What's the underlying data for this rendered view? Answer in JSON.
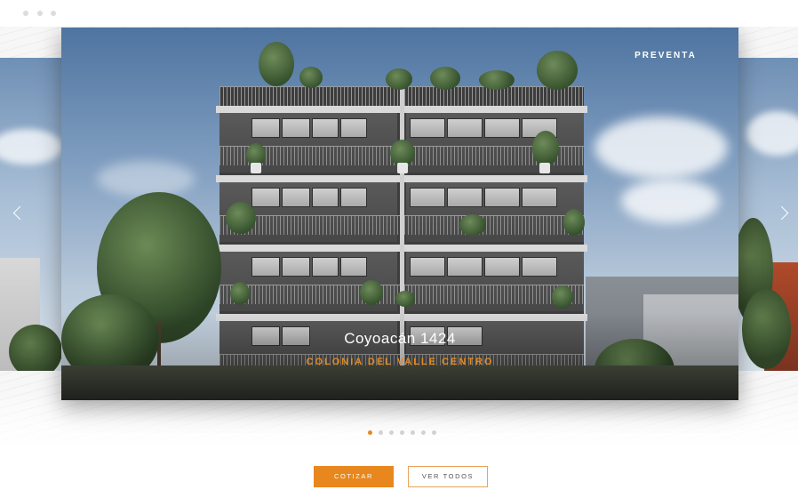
{
  "slide": {
    "badge": "PREVENTA",
    "title": "Coyoacán 1424",
    "subtitle": "COLONIA DEL VALLE CENTRO"
  },
  "carousel": {
    "slide_count": 7,
    "active_index": 0,
    "prev_icon": "chevron-left-icon",
    "next_icon": "chevron-right-icon"
  },
  "actions": {
    "primary_label": "COTIZAR",
    "secondary_label": "VER TODOS"
  },
  "colors": {
    "accent": "#e8871e",
    "text_light": "#ffffff",
    "dot_inactive": "#d2d2d2"
  }
}
